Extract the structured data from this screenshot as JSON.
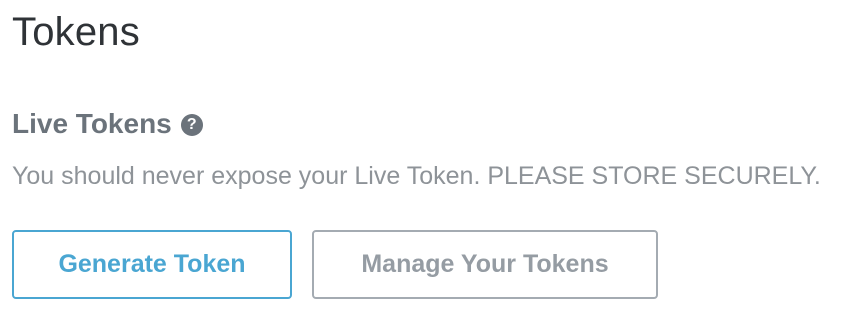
{
  "page": {
    "title": "Tokens"
  },
  "live_tokens": {
    "heading": "Live Tokens",
    "help_icon": "question-circle-icon",
    "help_glyph": "?",
    "description": "You should never expose your Live Token. PLEASE STORE SECURELY."
  },
  "actions": {
    "generate_label": "Generate Token",
    "manage_label": "Manage Your Tokens"
  },
  "colors": {
    "title_text": "#2f3337",
    "heading_text": "#6b737b",
    "description_text": "#8e9398",
    "primary_accent": "#4aa6d2",
    "secondary_border": "#a4abb2",
    "secondary_text": "#959ca3"
  }
}
